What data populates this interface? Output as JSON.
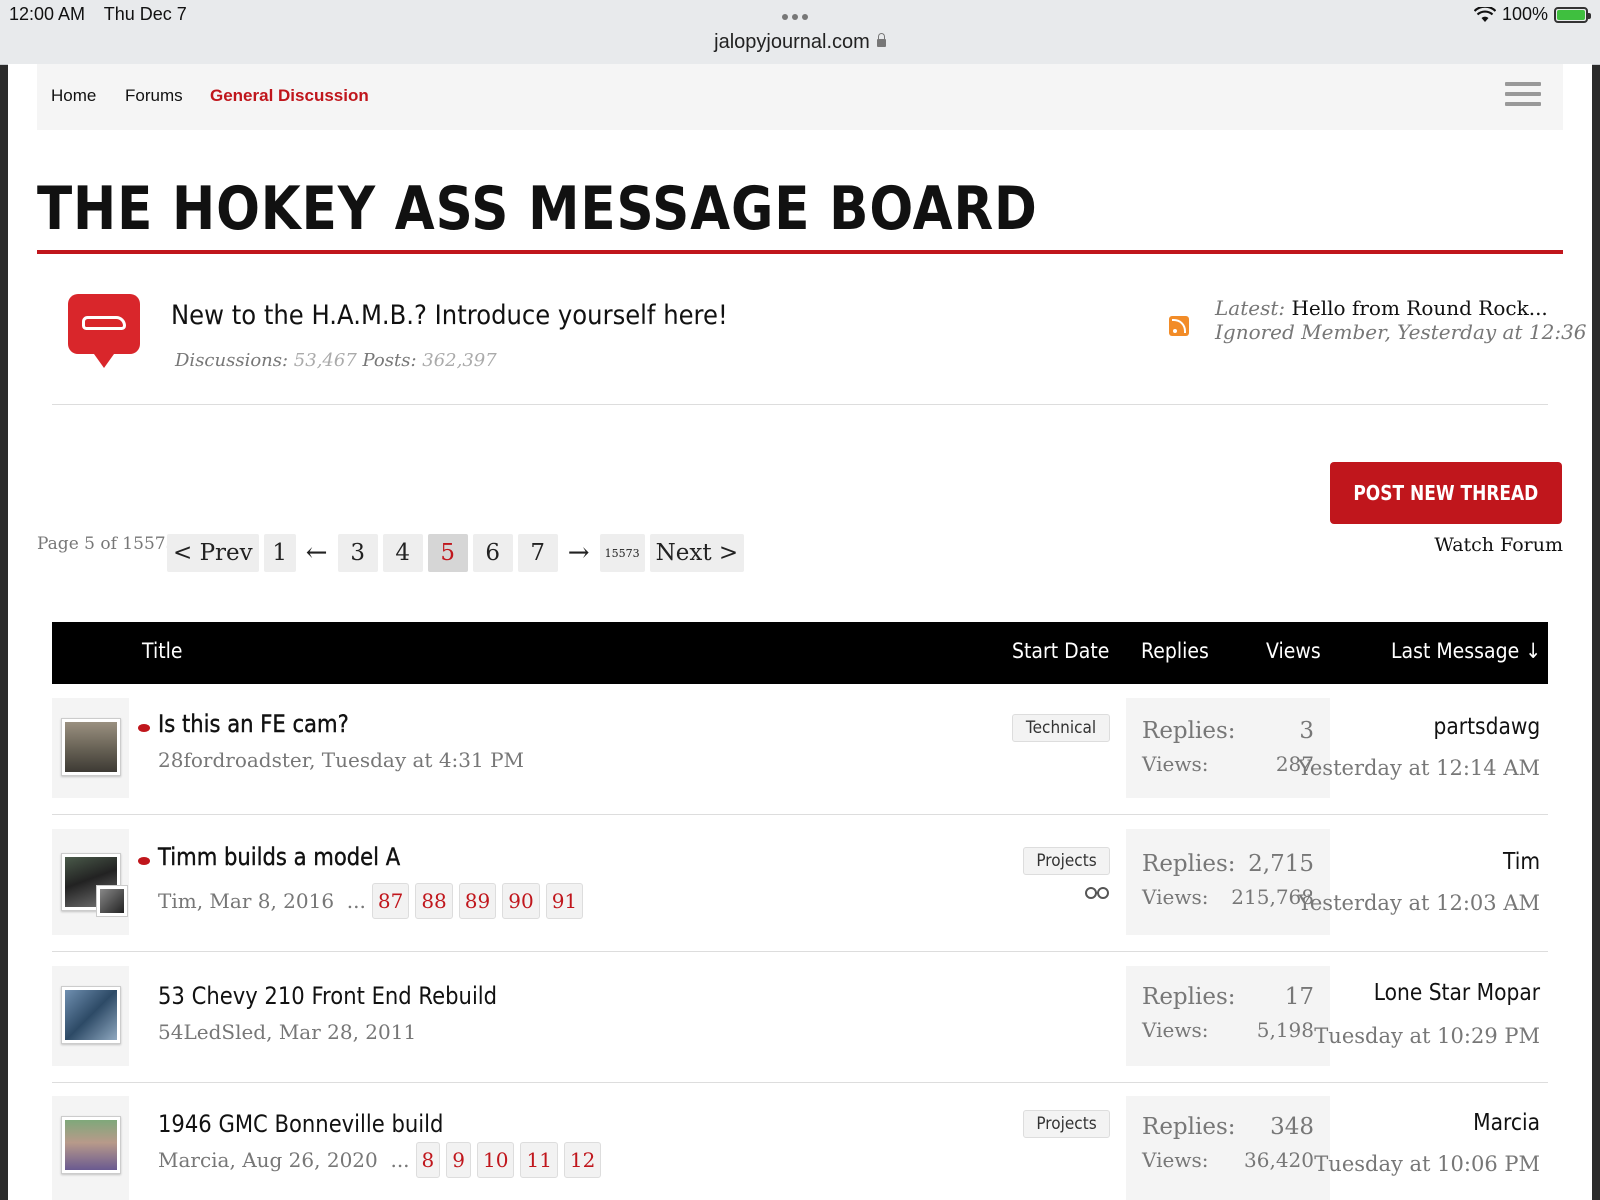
{
  "status_bar": {
    "time": "12:00 AM",
    "date": "Thu Dec 7",
    "url": "jalopyjournal.com",
    "battery": "100%"
  },
  "nav": {
    "home": "Home",
    "forums": "Forums",
    "current": "General Discussion"
  },
  "board_title": "THE HOKEY ASS MESSAGE BOARD",
  "featured": {
    "title": "New to the H.A.M.B.? Introduce yourself here!",
    "discussions_label": "Discussions:",
    "discussions": "53,467",
    "posts_label": "Posts:",
    "posts": "362,397",
    "latest_label": "Latest:",
    "latest_title": "Hello from Round Rock...",
    "latest_meta": "Ignored Member, Yesterday at 12:36"
  },
  "post_button": "POST NEW THREAD",
  "pagination": {
    "page_of": "Page 5 of 15573",
    "prev": "< Prev",
    "first": "1",
    "left_arrow": "←",
    "pages": [
      "3",
      "4",
      "5",
      "6",
      "7"
    ],
    "right_arrow": "→",
    "last": "15573",
    "next": "Next >"
  },
  "watch_forum": "Watch Forum",
  "table_header": {
    "title": "Title",
    "start_date": "Start Date",
    "replies": "Replies",
    "views": "Views",
    "last_message": "Last Message ↓"
  },
  "threads": [
    {
      "title": "Is this an FE cam?",
      "meta": "28fordroadster, Tuesday at 4:31 PM",
      "prefix": "Technical",
      "replies_label": "Replies:",
      "replies": "3",
      "views_label": "Views:",
      "views": "287",
      "last_user": "partsdawg",
      "last_date": "Yesterday at 12:14 AM"
    },
    {
      "title": "Timm builds a model A",
      "meta": "Tim, Mar 8, 2016",
      "ellipsis": "...",
      "pages": [
        "87",
        "88",
        "89",
        "90",
        "91"
      ],
      "prefix": "Projects",
      "replies_label": "Replies:",
      "replies": "2,715",
      "views_label": "Views:",
      "views": "215,768",
      "last_user": "Tim",
      "last_date": "Yesterday at 12:03 AM"
    },
    {
      "title": "53 Chevy 210 Front End Rebuild",
      "meta": "54LedSled, Mar 28, 2011",
      "replies_label": "Replies:",
      "replies": "17",
      "views_label": "Views:",
      "views": "5,198",
      "last_user": "Lone Star Mopar",
      "last_date": "Tuesday at 10:29 PM"
    },
    {
      "title": "1946 GMC Bonneville build",
      "meta": "Marcia, Aug 26, 2020",
      "ellipsis": "...",
      "pages": [
        "8",
        "9",
        "10",
        "11",
        "12"
      ],
      "prefix": "Projects",
      "replies_label": "Replies:",
      "replies": "348",
      "views_label": "Views:",
      "views": "36,420",
      "last_user": "Marcia",
      "last_date": "Tuesday at 10:06 PM"
    }
  ]
}
